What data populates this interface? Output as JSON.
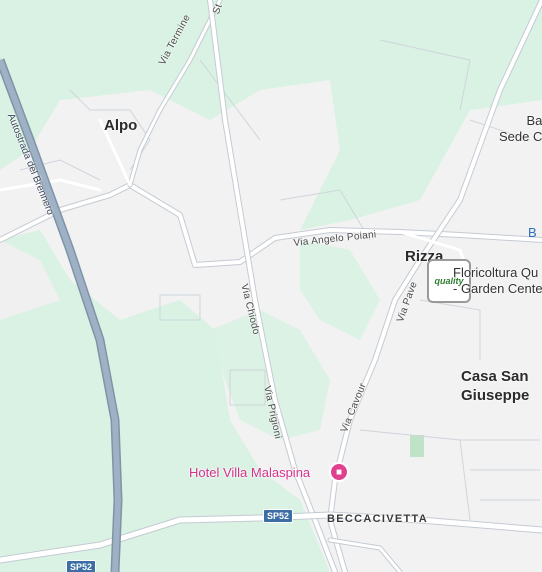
{
  "colors": {
    "land": "#d9f2e3",
    "urban": "#f2f2f2",
    "road": "#ffffff",
    "road_outline": "#c5cbd3",
    "highway": "#8ea2b8",
    "hotel": "#e0408f",
    "link_blue": "#2f6fbd"
  },
  "places": {
    "alpo": "Alpo",
    "rizza": "Rizza",
    "casa_san_giuseppe": "Casa San\nGiuseppe",
    "beccacivetta": "BECCACIVETTA"
  },
  "streets": {
    "via_termine": "Via Termine",
    "autostrada": "Autostrada del Brennero",
    "via_angelo_poiani": "Via Angelo Poiani",
    "via_chiodo": "Via Chiodo",
    "via_prigioni": "Via Prigioni",
    "via_pave": "Via Pave",
    "via_cavour": "Via Cavour",
    "top_partial": "St"
  },
  "shields": {
    "sp52_a": "SP52",
    "sp52_b": "SP52"
  },
  "pois": {
    "floricoltura": "Floricoltura Qu\n- Garden Cente",
    "floricoltura_icon": "quality",
    "hotel": "Hotel Villa Malaspina",
    "hotel_icon": "bed-icon",
    "right_top": "Ba\nSede C",
    "right_blue": "B"
  }
}
